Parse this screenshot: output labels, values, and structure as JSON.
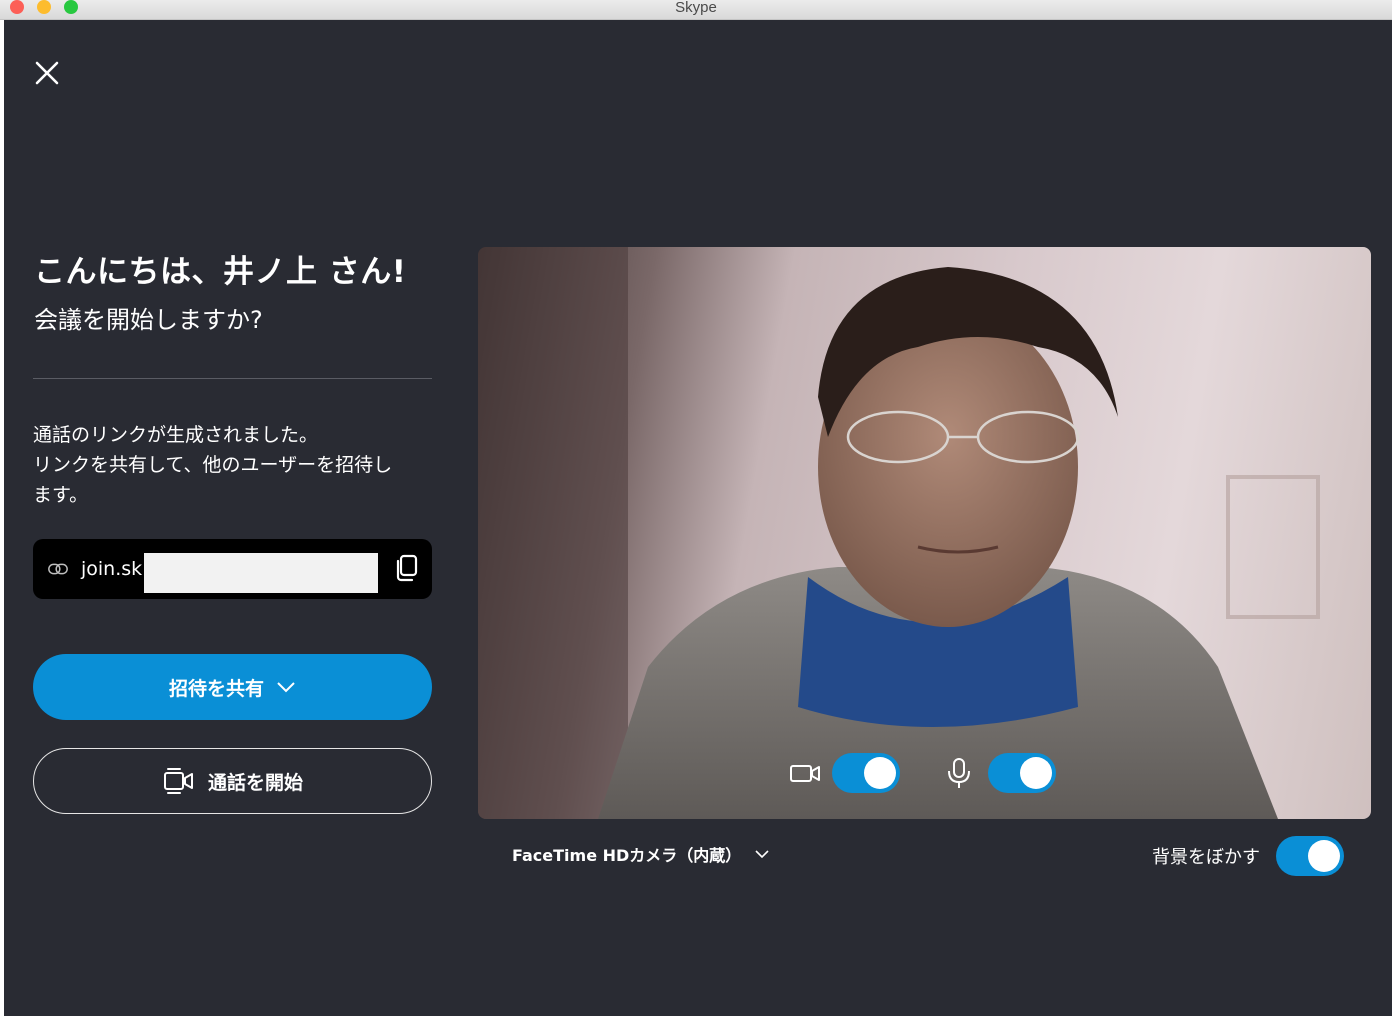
{
  "window": {
    "title": "Skype"
  },
  "greeting": {
    "title": "こんにちは、井ノ上 さん!",
    "subtitle": "会議を開始しますか?"
  },
  "link_section": {
    "description_line1": "通話のリンクが生成されました。",
    "description_line2": "リンクを共有して、他のユーザーを招待し",
    "description_line3": "ます。",
    "link_text": "join.sk"
  },
  "buttons": {
    "share_invite": "招待を共有",
    "start_call": "通話を開始"
  },
  "preview": {
    "camera_name": "FaceTime HDカメラ（内蔵）",
    "camera_toggle_on": true,
    "mic_toggle_on": true
  },
  "background_blur": {
    "label": "背景をぼかす",
    "on": true
  },
  "colors": {
    "accent": "#0a8fd6",
    "background": "#292b33",
    "link_box": "#000000"
  },
  "icons": [
    "close-icon",
    "link-icon",
    "copy-icon",
    "chevron-down-icon",
    "video-call-icon",
    "camera-icon",
    "microphone-icon"
  ]
}
